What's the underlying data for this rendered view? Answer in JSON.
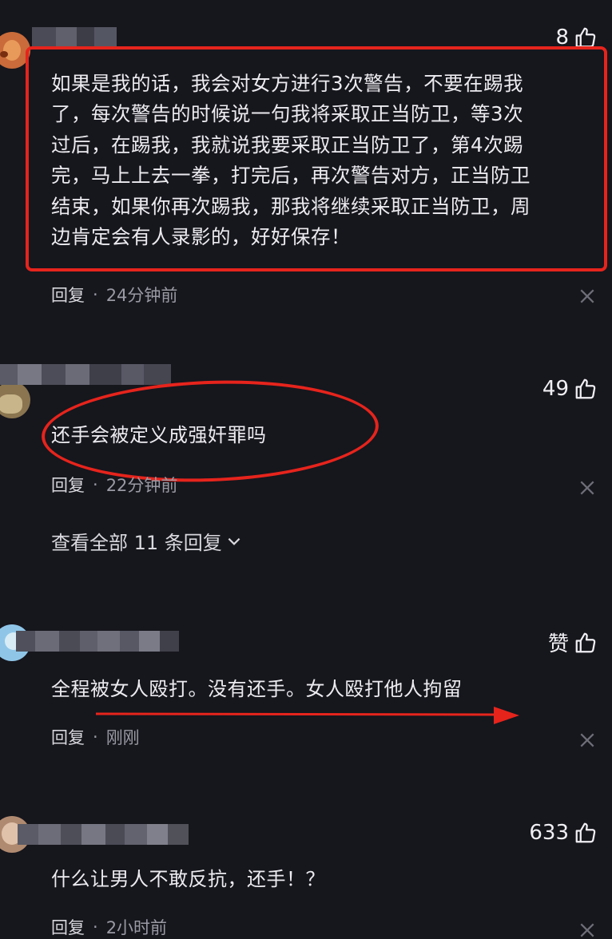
{
  "comments": [
    {
      "likes": "8",
      "text_lines": [
        "如果是我的话，我会对女方进行3次警告，不要在踢我",
        "了，每次警告的时候说一句我将采取正当防卫，等3次",
        "过后，在踢我，我就说我要采取正当防卫了，第4次踢",
        "完，马上上去一拳，打完后，再次警告对方，正当防卫",
        "结束，如果你再次踢我，那我将继续采取正当防卫，周",
        "边肯定会有人录影的，好好保存！"
      ],
      "reply_label": "回复",
      "time": "24分钟前"
    },
    {
      "likes": "49",
      "text": "还手会被定义成强奸罪吗",
      "reply_label": "回复",
      "time": "22分钟前",
      "view_all": "查看全部 11 条回复"
    },
    {
      "likes": "赞",
      "text": "全程被女人殴打。没有还手。女人殴打他人拘留",
      "reply_label": "回复",
      "time": "刚刚"
    },
    {
      "likes": "633",
      "text": "什么让男人不敢反抗，还手！？",
      "reply_label": "回复",
      "time": "2小时前"
    }
  ],
  "colors": {
    "background": "#16161d",
    "annotation_red": "#e6241c",
    "meta_gray": "#9a9aa4"
  },
  "icons": [
    "thumbs-up-icon",
    "close-icon",
    "chevron-down-icon"
  ]
}
